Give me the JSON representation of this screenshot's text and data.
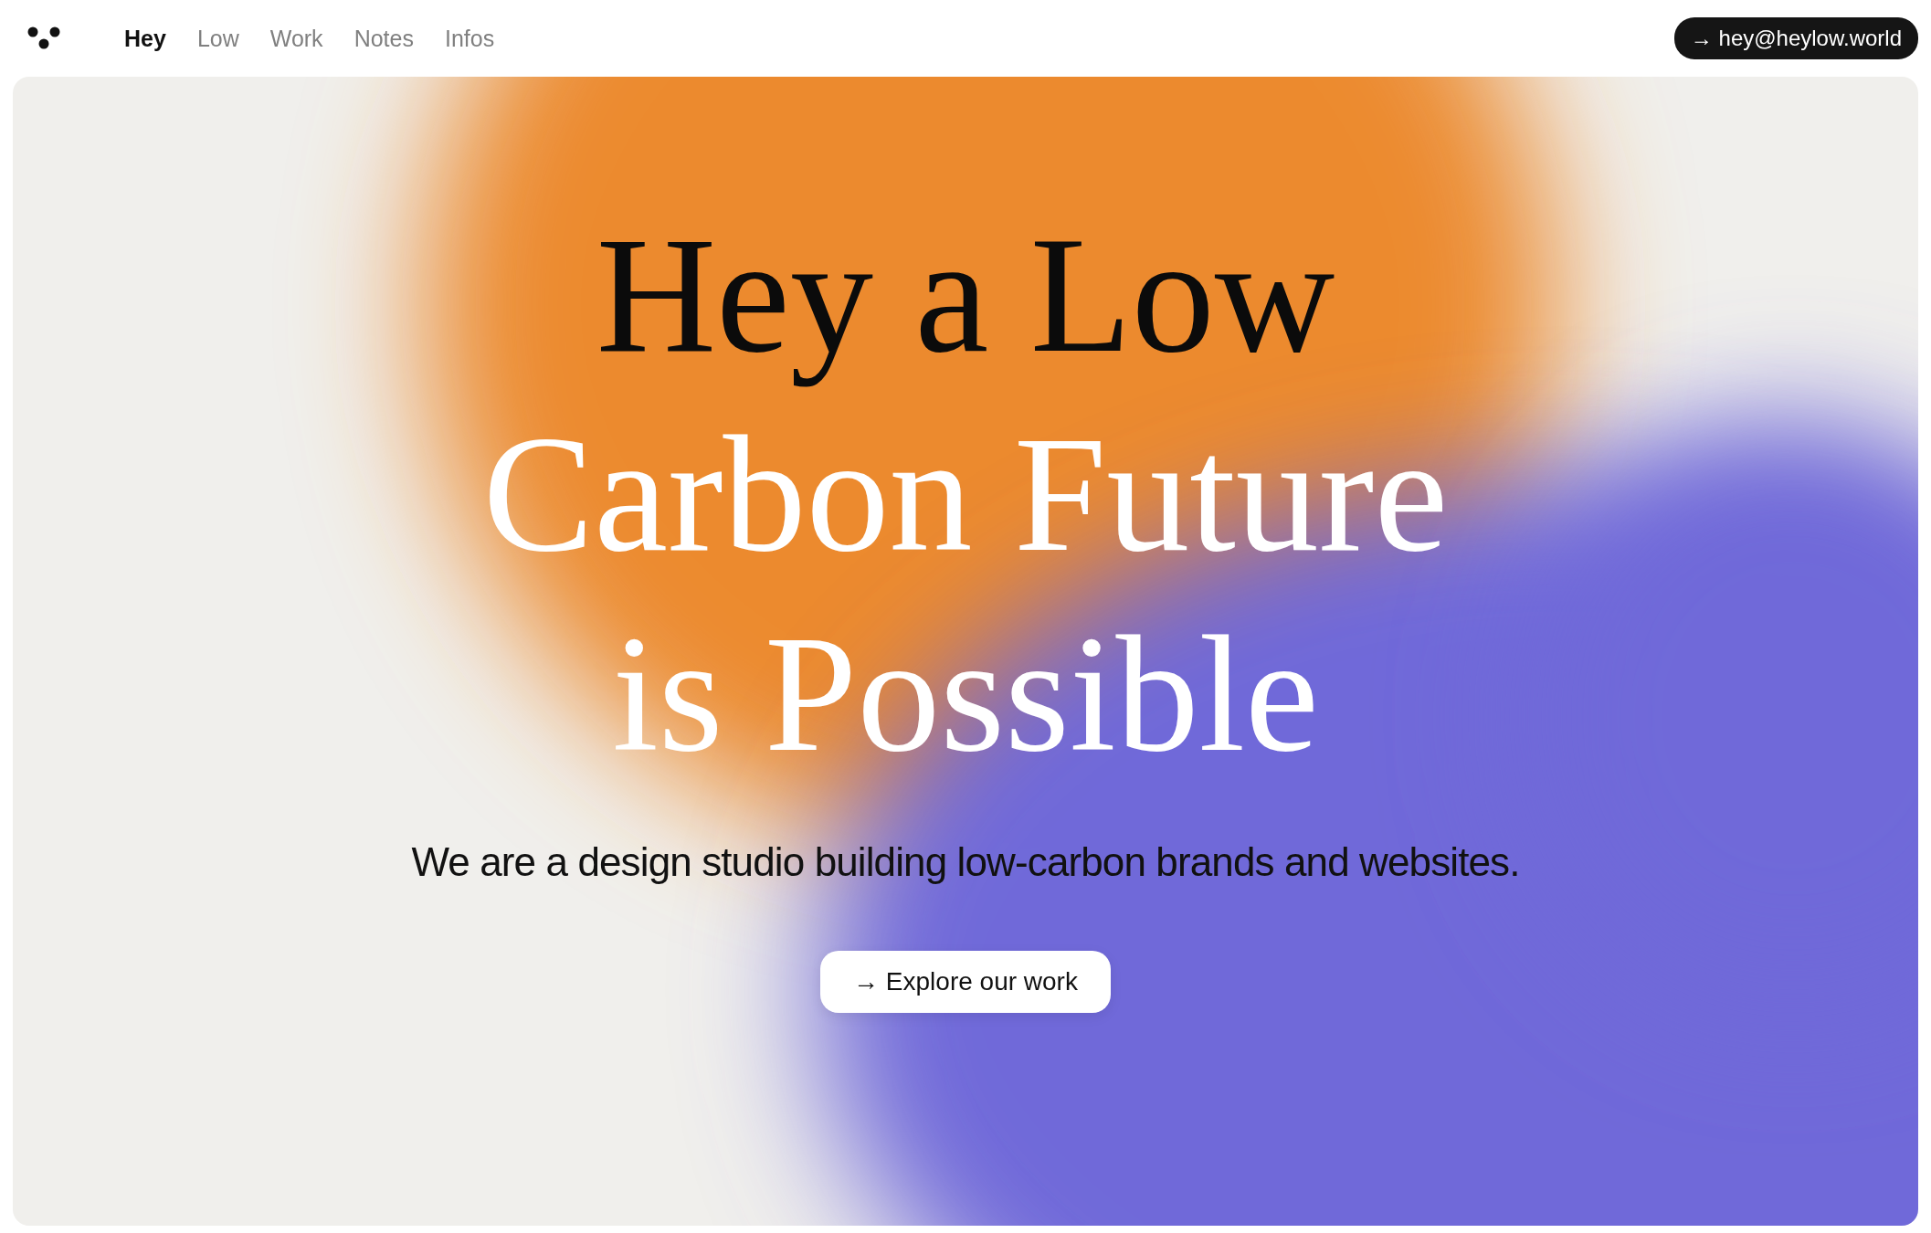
{
  "nav": {
    "items": [
      {
        "label": "Hey",
        "selected": true
      },
      {
        "label": "Low",
        "selected": false
      },
      {
        "label": "Work",
        "selected": false
      },
      {
        "label": "Notes",
        "selected": false
      },
      {
        "label": "Infos",
        "selected": false
      }
    ],
    "contact_button": {
      "arrow": "→",
      "label": "hey@heylow.world"
    }
  },
  "hero": {
    "headline": [
      {
        "text": "Hey a Low",
        "kind": "dark"
      },
      {
        "text": "Carbon Future",
        "kind": "light"
      },
      {
        "text": "is Possible",
        "kind": "light"
      }
    ],
    "subtitle": "We are a design studio building low-carbon brands and websites.",
    "button": {
      "arrow": "→",
      "label": "Explore our work"
    }
  }
}
